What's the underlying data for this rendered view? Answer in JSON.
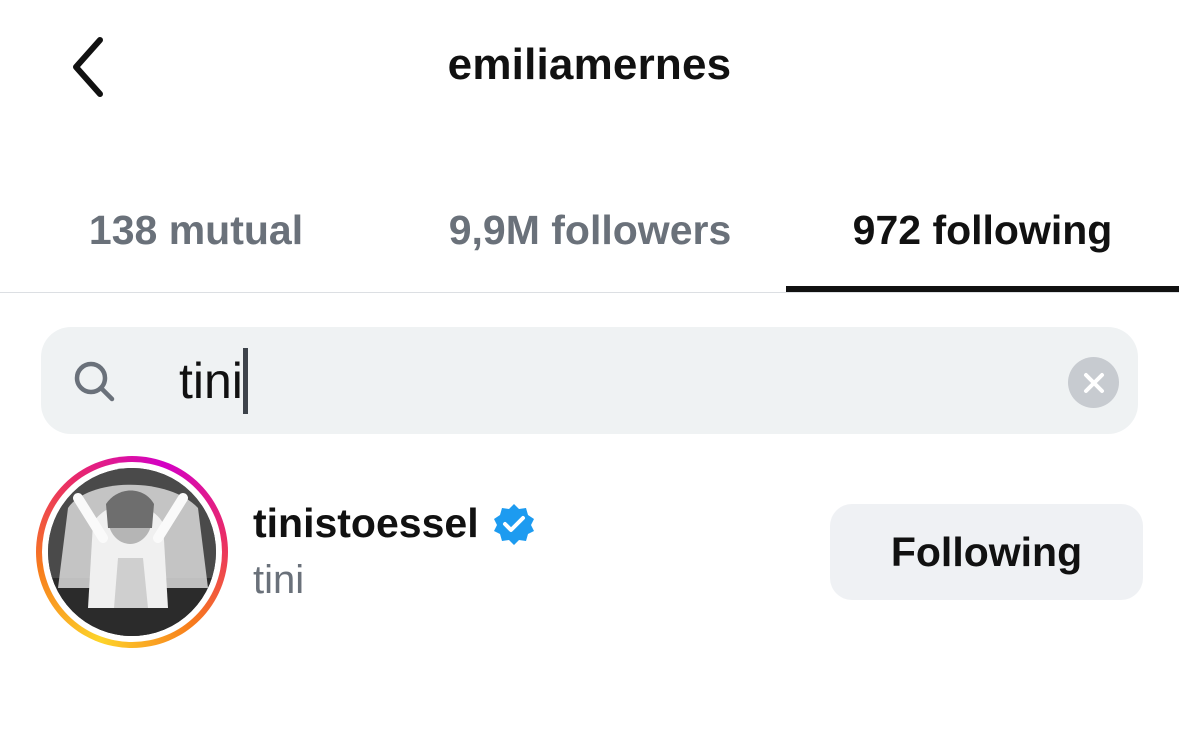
{
  "header": {
    "title": "emiliamernes",
    "back_icon": "chevron-left-icon"
  },
  "tabs": [
    {
      "label": "138 mutual",
      "active": false
    },
    {
      "label": "9,9M followers",
      "active": false
    },
    {
      "label": "972 following",
      "active": true
    }
  ],
  "search": {
    "value": "tini",
    "search_icon": "search-icon",
    "clear_icon": "close-icon"
  },
  "results": [
    {
      "username": "tinistoessel",
      "verified": true,
      "full_name": "tini",
      "button_label": "Following"
    }
  ],
  "colors": {
    "verified_blue": "#1d9bf0",
    "muted_text": "#6a717a",
    "search_bg": "#eff2f3",
    "button_bg": "#eff1f4"
  }
}
